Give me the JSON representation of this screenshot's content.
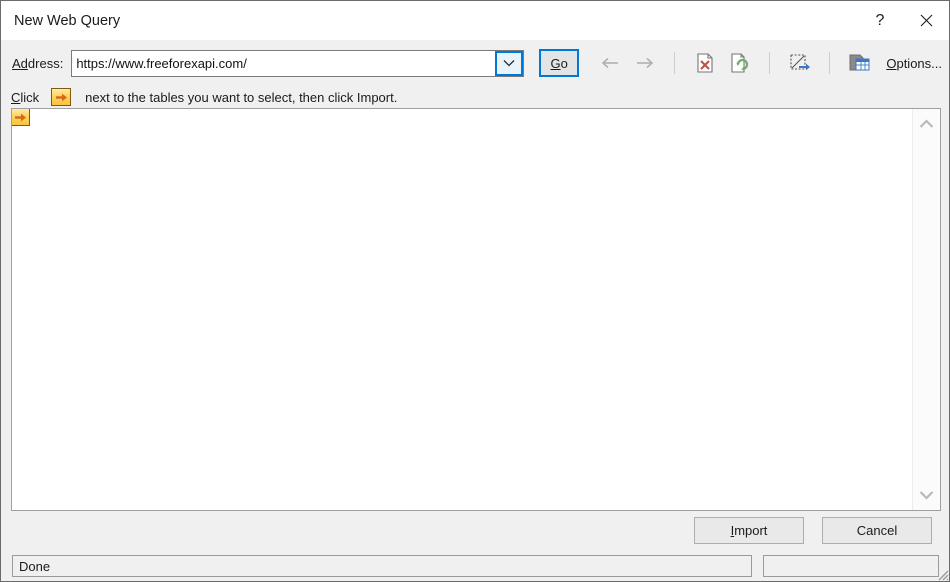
{
  "window": {
    "title": "New Web Query",
    "help_button": "?",
    "close_button": "✕"
  },
  "address_bar": {
    "label_prefix": "A",
    "label_accel": "d",
    "label_suffix": "dress:",
    "value": "https://www.freeforexapi.com/",
    "placeholder": "",
    "dropdown_icon": "chevron-down-icon",
    "go_button": {
      "accel": "G",
      "rest": "o"
    },
    "toolbar": [
      {
        "name": "back-icon",
        "label": "Back",
        "enabled": false
      },
      {
        "name": "forward-icon",
        "label": "Forward",
        "enabled": false
      },
      {
        "name": "stop-icon",
        "label": "Stop",
        "enabled": true
      },
      {
        "name": "refresh-icon",
        "label": "Refresh",
        "enabled": true
      },
      {
        "name": "hide-icons-icon",
        "label": "Hide Icons",
        "enabled": false
      },
      {
        "name": "options-table-icon",
        "label": "Options",
        "enabled": true
      }
    ],
    "options_link": {
      "accel": "O",
      "rest": "ptions..."
    }
  },
  "hint": {
    "click_accel": "C",
    "click_rest": "lick",
    "arrow_icon": "yellow-arrow-select-icon",
    "text": "next to the tables you want to select, then click Import."
  },
  "page": {
    "select_arrow_icon": "yellow-arrow-select-icon",
    "content": ""
  },
  "scrollbar": {
    "up_icon": "chevron-up-icon",
    "down_icon": "chevron-down-icon"
  },
  "footer": {
    "import": {
      "accel": "I",
      "rest": "mport"
    },
    "cancel": "Cancel"
  },
  "status": {
    "message": "Done",
    "secondary": ""
  },
  "colors": {
    "focus_blue": "#0078d7",
    "arrow_gold": "#fbc23d",
    "stop_red": "#c0504d",
    "refresh_green": "#6fae6a",
    "window_bg": "#f0f0f0"
  }
}
